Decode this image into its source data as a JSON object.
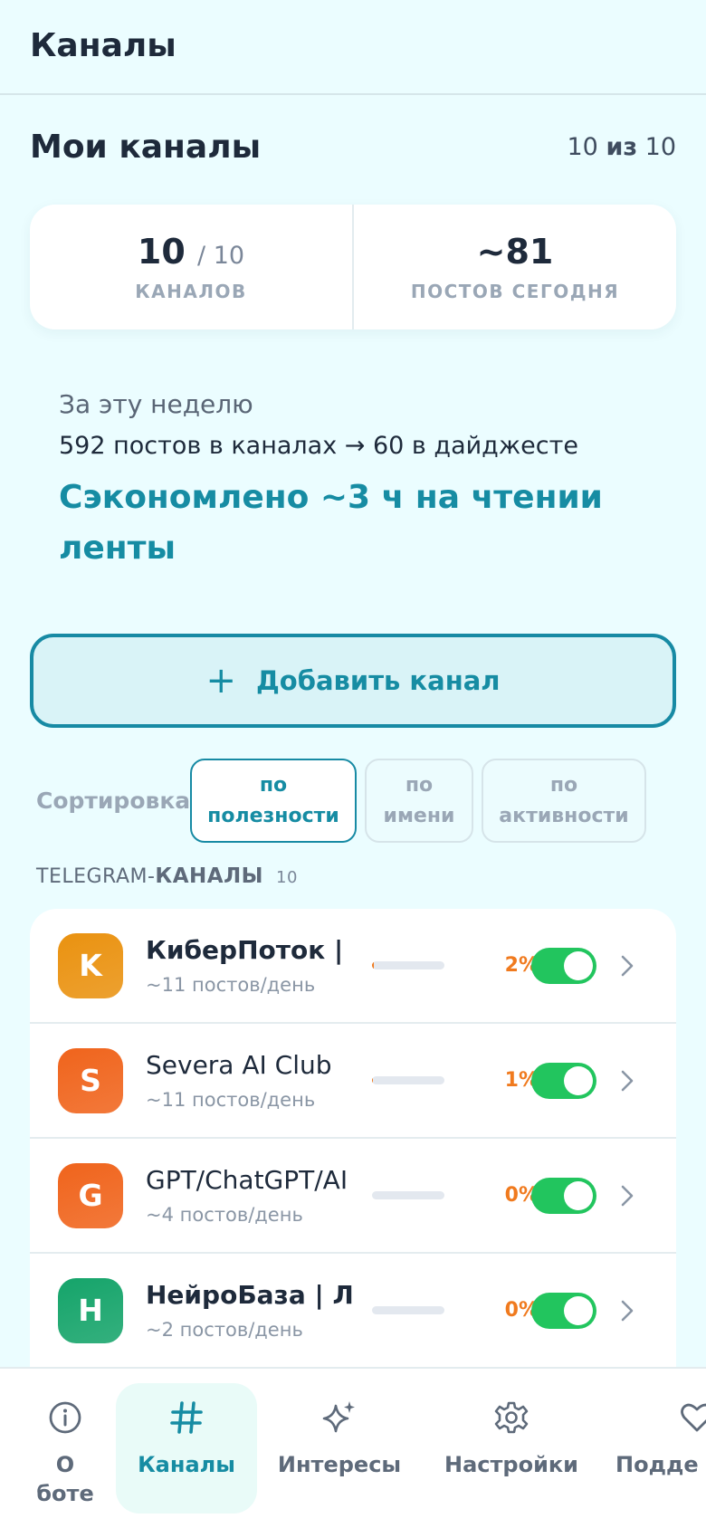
{
  "header": {
    "title": "Каналы"
  },
  "my_channels": {
    "title": "Мои каналы",
    "count_used": "10",
    "count_sep": "из",
    "count_total": "10"
  },
  "stats": {
    "channels_value": "10",
    "channels_limit": "/ 10",
    "channels_caption": "КАНАЛОВ",
    "posts_value": "~81",
    "posts_caption": "ПОСТОВ СЕГОДНЯ"
  },
  "week": {
    "label": "За эту неделю",
    "summary": "592 постов в каналах → 60 в дайджесте",
    "saved": "Сэкономлено ~3 ч на чтении ленты"
  },
  "add_button": {
    "icon": "+",
    "label": "Добавить канал"
  },
  "sort": {
    "label": "Сортировка:",
    "options": [
      {
        "line1": "по",
        "line2": "полезности",
        "active": true
      },
      {
        "line1": "по",
        "line2": "имени",
        "active": false
      },
      {
        "line1": "по",
        "line2": "активности",
        "active": false
      }
    ]
  },
  "channels_header": {
    "prefix": "TELEGRAM-",
    "title": "КАНАЛЫ",
    "count": "10"
  },
  "channels": [
    {
      "letter": "K",
      "name": "КиберПоток | I",
      "posts": "~11 постов/день",
      "usefulness": 2,
      "pct": "2%",
      "enabled": true,
      "color": "#ea9210"
    },
    {
      "letter": "S",
      "name": "Severa AI Club",
      "posts": "~11 постов/день",
      "usefulness": 1,
      "pct": "1%",
      "enabled": true,
      "color": "#f0641c"
    },
    {
      "letter": "G",
      "name": "GPT/ChatGPT/AI",
      "posts": "~4 постов/день",
      "usefulness": 0,
      "pct": "0%",
      "enabled": true,
      "color": "#f0641c"
    },
    {
      "letter": "Н",
      "name": "НейроБаза | Ла",
      "posts": "~2 постов/день",
      "usefulness": 0,
      "pct": "0%",
      "enabled": true,
      "color": "#15a46a"
    }
  ],
  "nav": {
    "about_line1": "О",
    "about_line2": "боте",
    "channels": "Каналы",
    "interests": "Интересы",
    "settings": "Настройки",
    "support": "Подде"
  },
  "colors": {
    "accent": "#168ca3",
    "toggle_on": "#22c55e",
    "percent": "#f07a1e",
    "background": "#ebfdff"
  }
}
